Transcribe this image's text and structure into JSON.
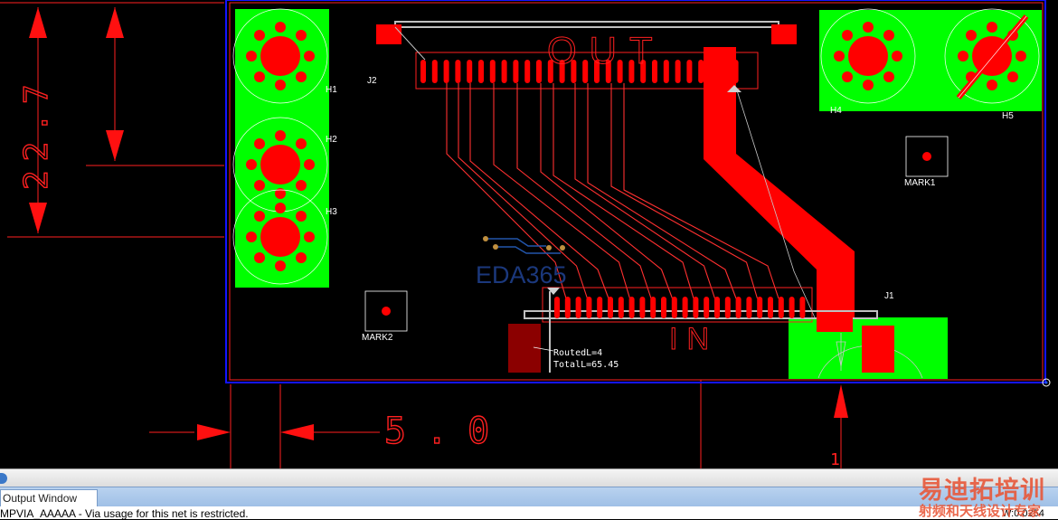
{
  "canvas": {
    "dimension_vertical": "22.7",
    "dimension_horizontal": "5.0",
    "silk_top_label": "OUT",
    "silk_bottom_label": "IN",
    "watermark": "EDA365",
    "routing_info": {
      "routed": "RoutedL=4",
      "total": "TotalL=65.45"
    },
    "refdes": {
      "h1": "H1",
      "h2": "H2",
      "h3": "H3",
      "h4": "H4",
      "h5": "H5",
      "j1": "J1",
      "j2": "J2",
      "mark1": "MARK1",
      "mark2": "MARK2"
    },
    "colors": {
      "background": "#000000",
      "copper": "#ff0000",
      "plane": "#00ff00",
      "outline": "#1010ff",
      "silkscreen": "#ff2020",
      "trace_thin": "#ff3030",
      "dark_pad": "#8b0000"
    }
  },
  "output_window": {
    "tab_label": "Output Window",
    "message": "MPVIA_AAAAA - Via usage for this net is restricted.",
    "coord": "W:0.0254"
  },
  "brand_watermark": {
    "title": "易迪拓培训",
    "subtitle": "射频和天线设计专家"
  }
}
